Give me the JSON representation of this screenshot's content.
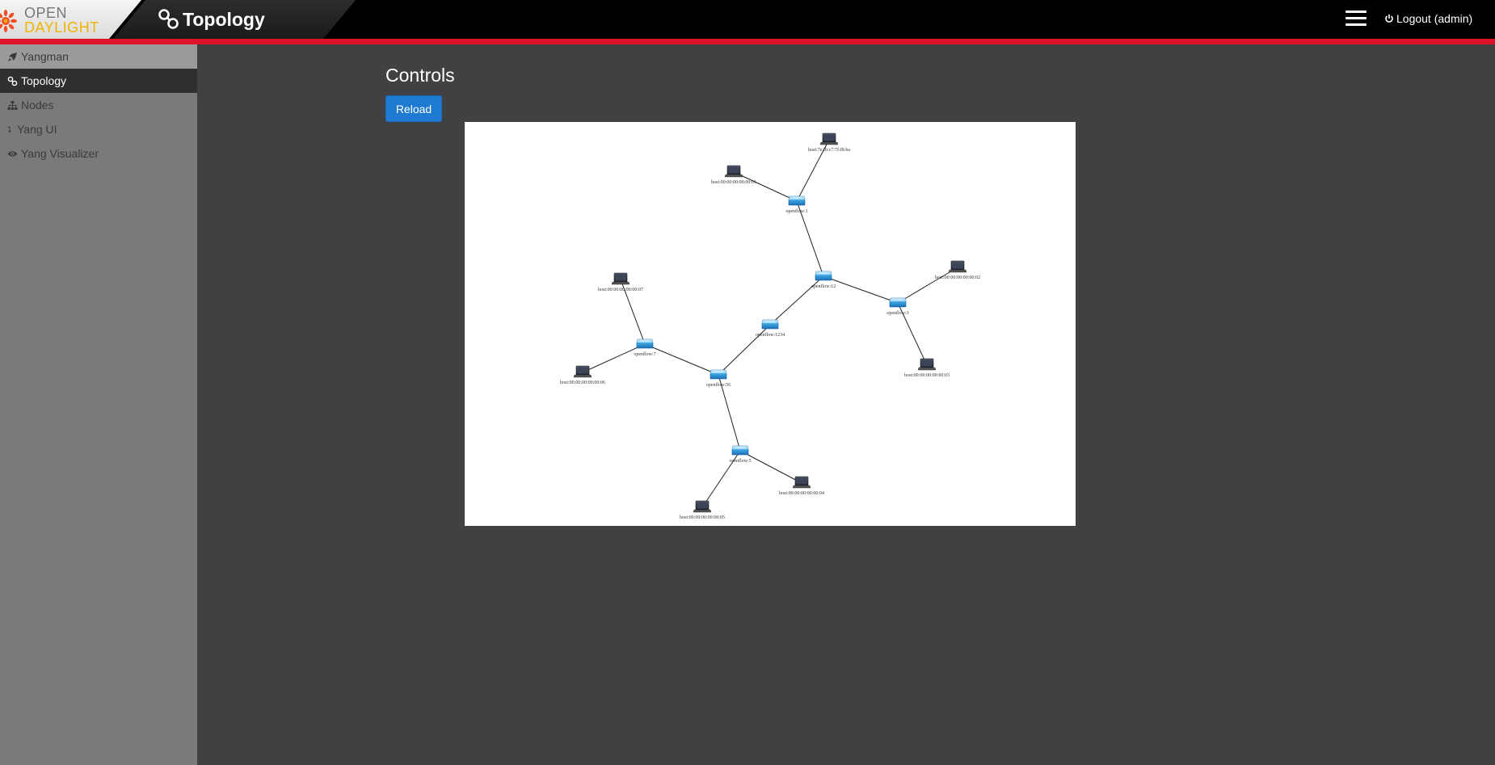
{
  "header": {
    "logo_line1": "OPEN",
    "logo_line2": "DAYLIGHT",
    "title": "Topology",
    "logout_label": "Logout (admin)"
  },
  "sidebar": {
    "items": [
      {
        "label": "Yangman",
        "icon": "rocket-icon"
      },
      {
        "label": "Topology",
        "icon": "link-icon",
        "active": true
      },
      {
        "label": "Nodes",
        "icon": "sitemap-icon"
      },
      {
        "label": "Yang UI",
        "icon": "level-down-icon"
      },
      {
        "label": "Yang Visualizer",
        "icon": "eye-icon"
      }
    ]
  },
  "main": {
    "title": "Controls",
    "reload_label": "Reload"
  },
  "topology": {
    "nodes": [
      {
        "id": "h1",
        "type": "host",
        "label": "host:7e:fb:c7:7f:f8:ba"
      },
      {
        "id": "h2",
        "type": "host",
        "label": "host:00:00:00:00:00:01"
      },
      {
        "id": "s1",
        "type": "switch",
        "label": "openflow:1"
      },
      {
        "id": "s12",
        "type": "switch",
        "label": "openflow:12"
      },
      {
        "id": "s3",
        "type": "switch",
        "label": "openflow:3"
      },
      {
        "id": "h3",
        "type": "host",
        "label": "host:00:00:00:00:00:02"
      },
      {
        "id": "h4",
        "type": "host",
        "label": "host:00:00:00:00:00:03"
      },
      {
        "id": "s1234",
        "type": "switch",
        "label": "openflow:1234"
      },
      {
        "id": "h5",
        "type": "host",
        "label": "host:00:00:00:00:00:07"
      },
      {
        "id": "s7",
        "type": "switch",
        "label": "openflow:7"
      },
      {
        "id": "h6",
        "type": "host",
        "label": "host:00:00:00:00:00:06"
      },
      {
        "id": "s56",
        "type": "switch",
        "label": "openflow:56"
      },
      {
        "id": "s5",
        "type": "switch",
        "label": "openflow:5"
      },
      {
        "id": "h7",
        "type": "host",
        "label": "host:00:00:00:00:00:04"
      },
      {
        "id": "h8",
        "type": "host",
        "label": "host:00:00:00:00:00:05"
      }
    ],
    "links": [
      [
        "h1",
        "s1"
      ],
      [
        "h2",
        "s1"
      ],
      [
        "s1",
        "s12"
      ],
      [
        "s12",
        "s3"
      ],
      [
        "s3",
        "h3"
      ],
      [
        "s3",
        "h4"
      ],
      [
        "s12",
        "s1234"
      ],
      [
        "s1234",
        "s56"
      ],
      [
        "s56",
        "s7"
      ],
      [
        "s7",
        "h5"
      ],
      [
        "s7",
        "h6"
      ],
      [
        "s56",
        "s5"
      ],
      [
        "s5",
        "h7"
      ],
      [
        "s5",
        "h8"
      ]
    ]
  }
}
